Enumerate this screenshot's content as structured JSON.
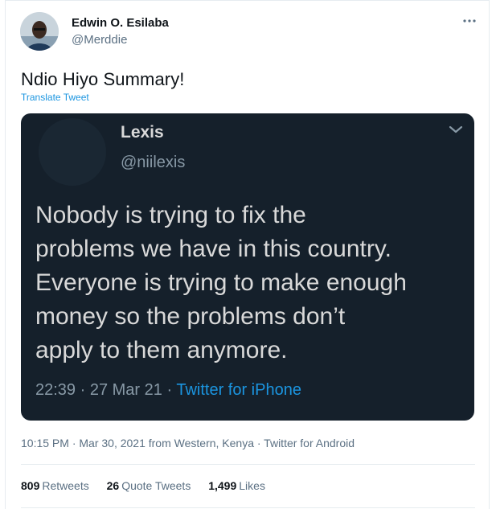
{
  "author": {
    "name": "Edwin O. Esilaba",
    "handle": "@Merddie",
    "more_icon": "more-horizontal-icon"
  },
  "tweet": {
    "text": "Ndio Hiyo Summary!",
    "translate_label": "Translate Tweet"
  },
  "embedded": {
    "name": "Lexis",
    "handle": "@niilexis",
    "lines": [
      "Nobody is trying to fix the",
      "problems we have in this country.",
      "Everyone is trying to make enough",
      "money so the problems don’t",
      "apply to them anymore."
    ],
    "time": "22:39",
    "date": "27 Mar 21",
    "source": "Twitter for iPhone",
    "chevron_icon": "chevron-down-icon",
    "background": "#15202b"
  },
  "meta": {
    "text": "10:15 PM · Mar 30, 2021 from Western, Kenya · Twitter for Android"
  },
  "stats": {
    "retweets_count": "809",
    "retweets_label": "Retweets",
    "quotes_count": "26",
    "quotes_label": "Quote Tweets",
    "likes_count": "1,499",
    "likes_label": "Likes"
  },
  "colors": {
    "accent": "#1b95e0",
    "secondary_text": "#5b7083"
  }
}
